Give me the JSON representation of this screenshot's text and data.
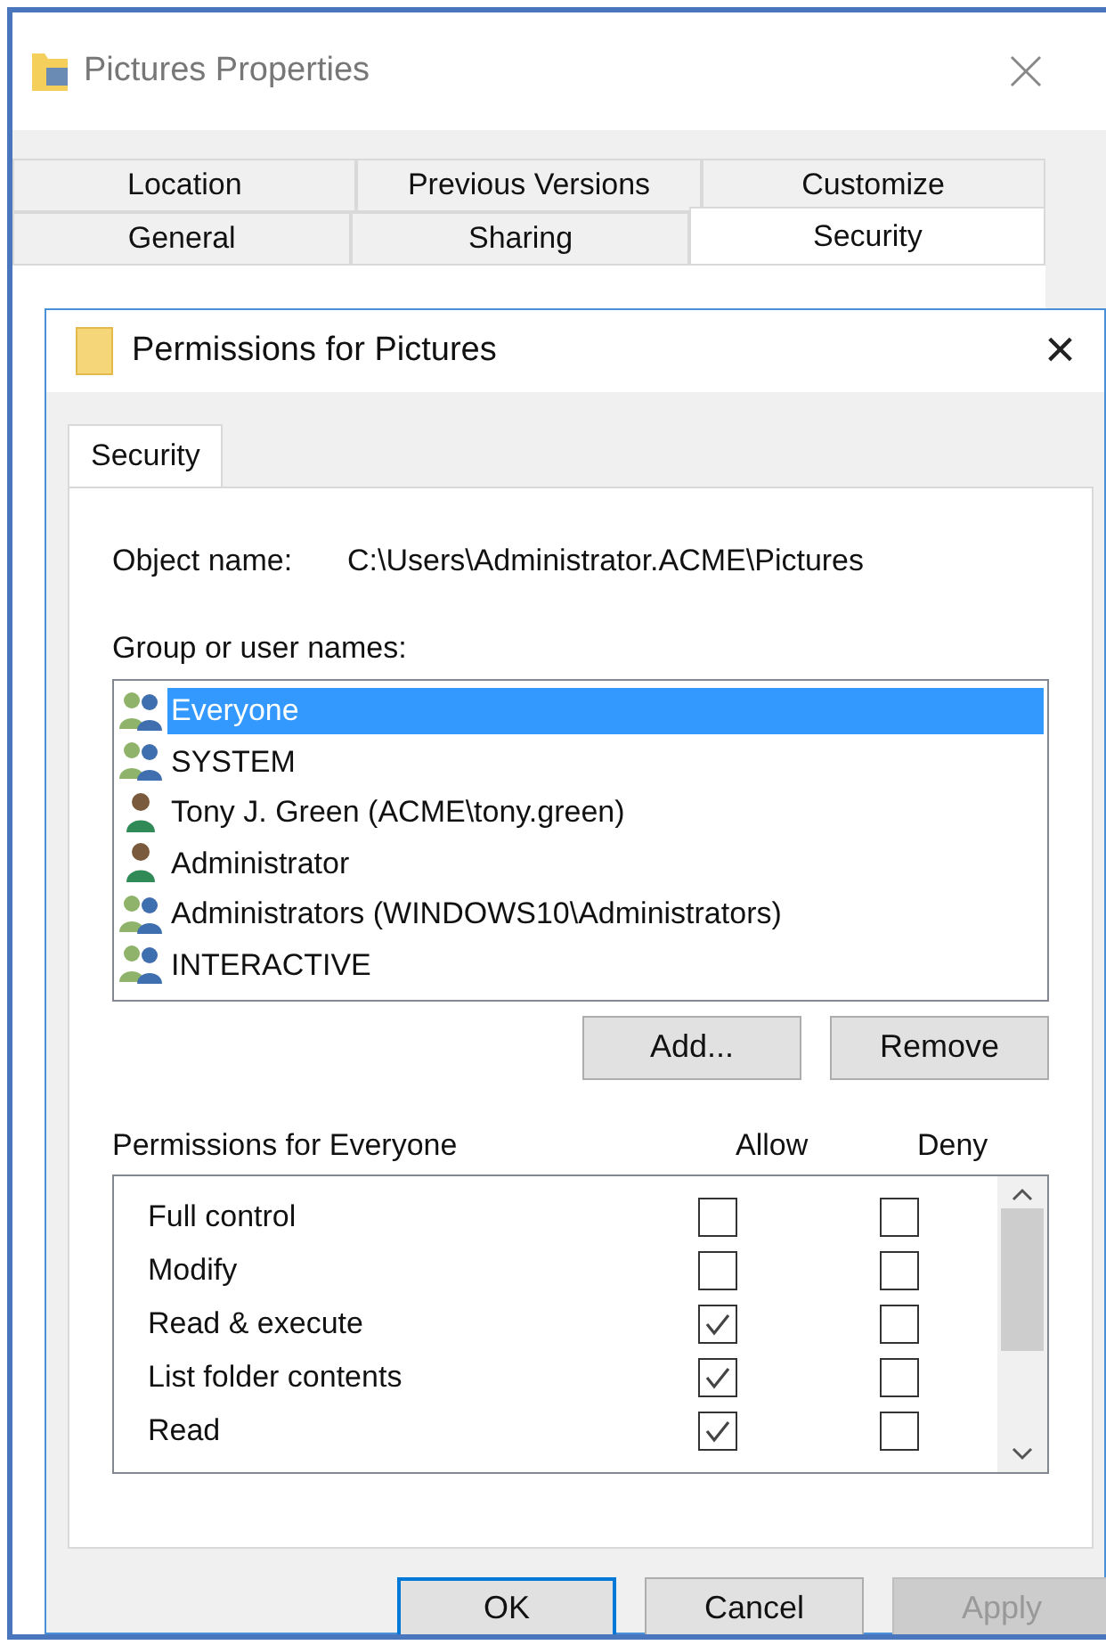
{
  "back_window": {
    "title": "Pictures Properties",
    "tab_rows": [
      [
        {
          "label": "Location",
          "selected": false
        },
        {
          "label": "Previous Versions",
          "selected": false
        },
        {
          "label": "Customize",
          "selected": false
        }
      ],
      [
        {
          "label": "General",
          "selected": false
        },
        {
          "label": "Sharing",
          "selected": false
        },
        {
          "label": "Security",
          "selected": true
        }
      ]
    ]
  },
  "dialog": {
    "title": "Permissions for Pictures",
    "close": "×",
    "tabs": [
      {
        "label": "Security",
        "selected": true
      }
    ],
    "object_label": "Object name:",
    "object_value": "C:\\Users\\Administrator.ACME\\Pictures",
    "group_label": "Group or user names:",
    "principals": [
      {
        "kind": "group",
        "name": "Everyone",
        "selected": true
      },
      {
        "kind": "group",
        "name": "SYSTEM",
        "selected": false
      },
      {
        "kind": "user",
        "name": "Tony J. Green (ACME\\tony.green)",
        "selected": false
      },
      {
        "kind": "user",
        "name": "Administrator",
        "selected": false
      },
      {
        "kind": "group",
        "name": "Administrators (WINDOWS10\\Administrators)",
        "selected": false
      },
      {
        "kind": "group",
        "name": "INTERACTIVE",
        "selected": false
      }
    ],
    "principal_buttons": [
      "Add...",
      "Remove"
    ],
    "permissions_label": "Permissions for Everyone",
    "allow_label": "Allow",
    "deny_label": "Deny",
    "permissions": [
      {
        "name": "Full control",
        "allow": false,
        "deny": false
      },
      {
        "name": "Modify",
        "allow": false,
        "deny": false
      },
      {
        "name": "Read & execute",
        "allow": true,
        "deny": false
      },
      {
        "name": "List folder contents",
        "allow": true,
        "deny": false
      },
      {
        "name": "Read",
        "allow": true,
        "deny": false
      }
    ],
    "buttons": [
      {
        "label": "OK",
        "default": true,
        "disabled": false
      },
      {
        "label": "Cancel",
        "default": false,
        "disabled": false
      },
      {
        "label": "Apply",
        "default": false,
        "disabled": true
      }
    ]
  }
}
